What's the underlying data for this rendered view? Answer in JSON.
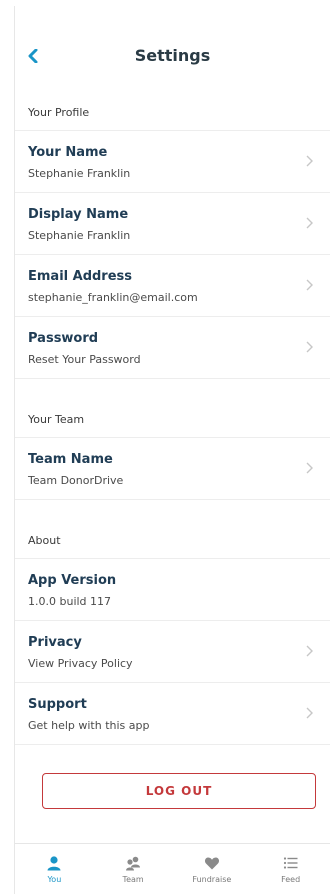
{
  "header": {
    "title": "Settings"
  },
  "sections": [
    {
      "label": "Your Profile",
      "rows": [
        {
          "title": "Your Name",
          "subtitle": "Stephanie Franklin",
          "chevron": true
        },
        {
          "title": "Display Name",
          "subtitle": "Stephanie Franklin",
          "chevron": true
        },
        {
          "title": "Email Address",
          "subtitle": "stephanie_franklin@email.com",
          "chevron": true
        },
        {
          "title": "Password",
          "subtitle": "Reset Your Password",
          "chevron": true
        }
      ]
    },
    {
      "label": "Your Team",
      "rows": [
        {
          "title": "Team Name",
          "subtitle": "Team DonorDrive",
          "chevron": true
        }
      ]
    },
    {
      "label": "About",
      "rows": [
        {
          "title": "App Version",
          "subtitle": "1.0.0 build 117",
          "chevron": false
        },
        {
          "title": "Privacy",
          "subtitle": "View Privacy Policy",
          "chevron": true
        },
        {
          "title": "Support",
          "subtitle": "Get help with this app",
          "chevron": true
        }
      ]
    }
  ],
  "logout_label": "LOG OUT",
  "tabs": [
    {
      "label": "You",
      "icon": "person-icon",
      "active": true
    },
    {
      "label": "Team",
      "icon": "team-icon",
      "active": false
    },
    {
      "label": "Fundraise",
      "icon": "heart-icon",
      "active": false
    },
    {
      "label": "Feed",
      "icon": "list-icon",
      "active": false
    }
  ],
  "colors": {
    "accent": "#1a95c7",
    "title_text": "#203d55",
    "logout_red": "#c4393b",
    "tab_inactive": "#7a7a7a"
  }
}
